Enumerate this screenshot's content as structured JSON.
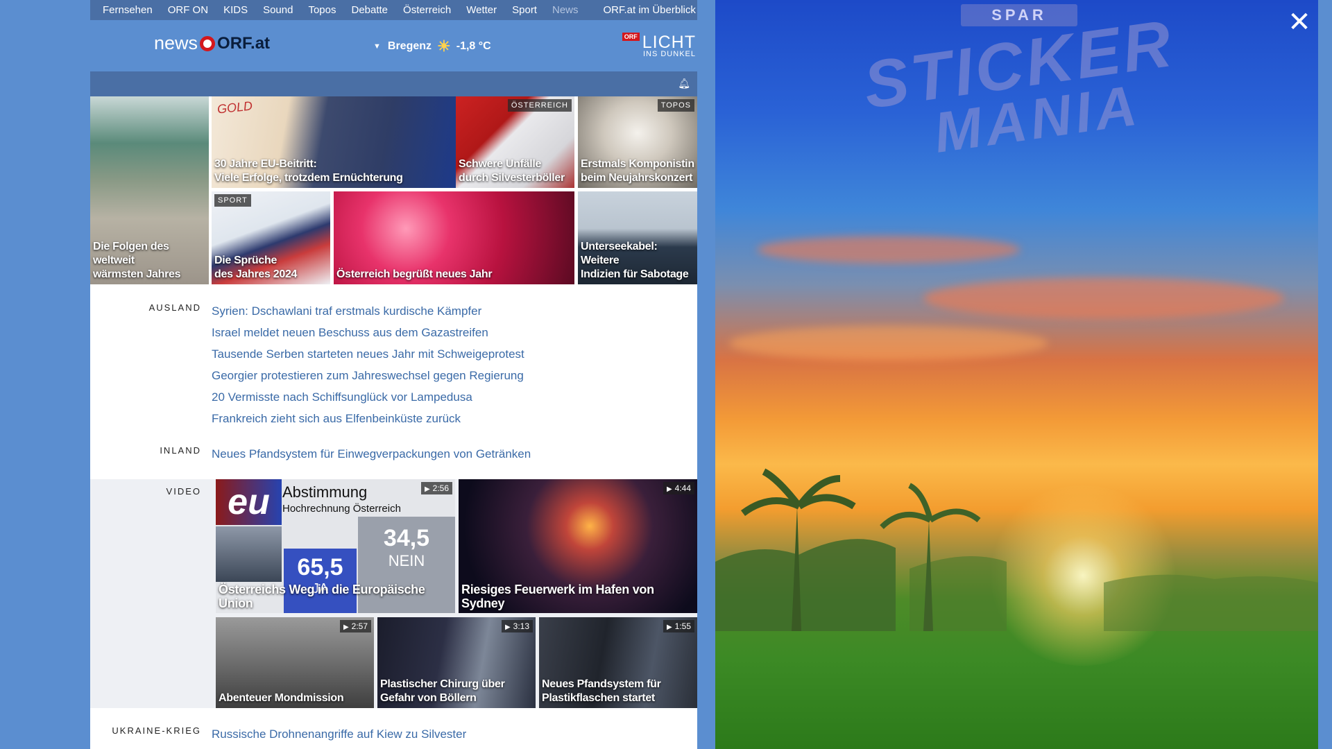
{
  "nav": {
    "items": [
      "Fernsehen",
      "ORF ON",
      "KIDS",
      "Sound",
      "Topos",
      "Debatte",
      "Österreich",
      "Wetter",
      "Sport",
      "News"
    ],
    "overview": "ORF.at im Überblick"
  },
  "header": {
    "logo_news": "news",
    "logo_orf": "ORF.at",
    "weather_city": "Bregenz",
    "weather_temp": "-1,8 °C",
    "licht_badge": "ORF",
    "licht_title": "LICHT",
    "licht_sub": "INS DUNKEL"
  },
  "tiles": {
    "eu": {
      "caption": "30 Jahre EU-Beitritt:\nViele Erfolge, trotzdem Ernüchterung"
    },
    "unfaelle": {
      "tag": "ÖSTERREICH",
      "caption": "Schwere Unfälle\ndurch Silvesterböller"
    },
    "komponistin": {
      "tag": "TOPOS",
      "caption": "Erstmals Komponistin\nbeim Neujahrskonzert"
    },
    "klima": {
      "caption": "Die Folgen des weltweit\nwärmsten Jahres"
    },
    "sprueche": {
      "tag": "SPORT",
      "caption": "Die Sprüche\ndes Jahres 2024"
    },
    "neujahr": {
      "caption": "Österreich begrüßt neues Jahr"
    },
    "seekabel": {
      "caption": "Unterseekabel: Weitere\nIndizien für Sabotage"
    }
  },
  "ausland": {
    "label": "AUSLAND",
    "links": [
      "Syrien: Dschawlani traf erstmals kurdische Kämpfer",
      "Israel meldet neuen Beschuss aus dem Gazastreifen",
      "Tausende Serben starteten neues Jahr mit Schweigeprotest",
      "Georgier protestieren zum Jahreswechsel gegen Regierung",
      "20 Vermisste nach Schiffsunglück vor Lampedusa",
      "Frankreich zieht sich aus Elfenbeinküste zurück"
    ]
  },
  "inland": {
    "label": "INLAND",
    "links": [
      "Neues Pfandsystem für Einwegverpackungen von Getränken"
    ]
  },
  "video": {
    "label": "VIDEO",
    "items": [
      {
        "duration": "2:56",
        "caption": "Österreichs Weg in die Europäische Union",
        "overlay_title": "Abstimmung",
        "overlay_sub": "Hochrechnung Österreich",
        "ja": "65,5",
        "ja_label": "JA",
        "nein": "34,5",
        "nein_label": "NEIN",
        "logo": "eu"
      },
      {
        "duration": "4:44",
        "caption": "Riesiges Feuerwerk im Hafen von Sydney"
      },
      {
        "duration": "2:57",
        "caption": "Abenteuer Mondmission"
      },
      {
        "duration": "3:13",
        "caption": "Plastischer Chirurg über\nGefahr von Böllern"
      },
      {
        "duration": "1:55",
        "caption": "Neues Pfandsystem für\nPlastikflaschen startet"
      }
    ]
  },
  "ukraine": {
    "label": "UKRAINE-KRIEG",
    "links": [
      "Russische Drohnenangriffe auf Kiew zu Silvester"
    ]
  },
  "ad": {
    "brand": "SPAR",
    "title_line1": "STICKER",
    "title_line2": "MANIA"
  },
  "colors": {
    "link": "#3a6aa7",
    "nav_bg": "#4a6fa5",
    "page_bg": "#5b8ed0",
    "orf_red": "#d4171c"
  }
}
